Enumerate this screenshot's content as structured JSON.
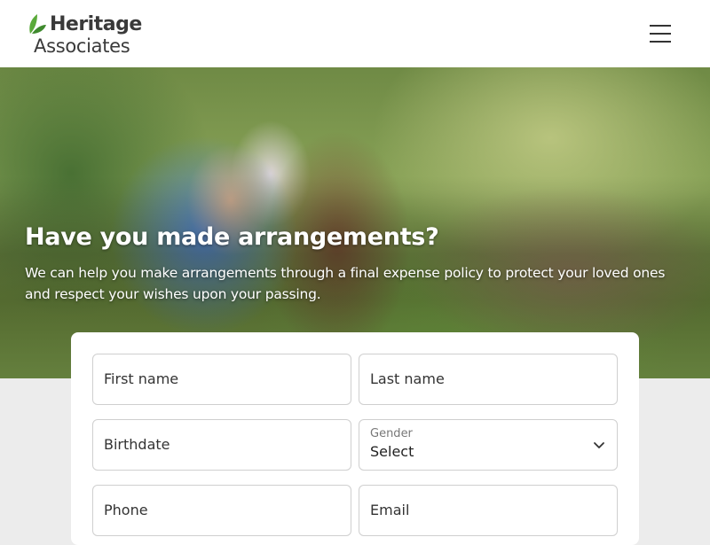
{
  "brand": {
    "name_line1": "Heritage",
    "name_line2": "Associates",
    "leaf_color": "#4a9a3a"
  },
  "header": {
    "menu_icon": "hamburger-menu-icon"
  },
  "hero": {
    "title": "Have you made arrangements?",
    "subtitle": "We can help you make arrangements through a final expense policy to protect your loved ones and respect your wishes upon your passing."
  },
  "form": {
    "first_name_placeholder": "First name",
    "last_name_placeholder": "Last name",
    "birthdate_placeholder": "Birthdate",
    "gender_label": "Gender",
    "gender_value": "Select",
    "phone_placeholder": "Phone",
    "email_placeholder": "Email"
  }
}
